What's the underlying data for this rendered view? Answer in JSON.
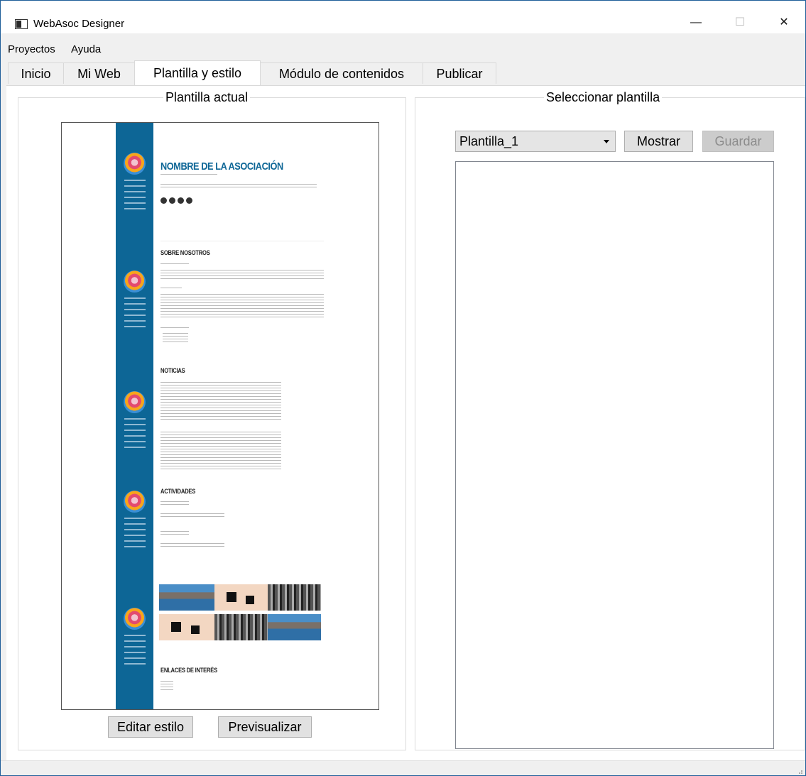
{
  "window": {
    "title": "WebAsoc Designer",
    "controls": {
      "minimize": "—",
      "maximize": "☐",
      "close": "✕"
    }
  },
  "menu": {
    "items": [
      "Proyectos",
      "Ayuda"
    ]
  },
  "tabs": [
    "Inicio",
    "Mi Web",
    "Plantilla y estilo",
    "Módulo de contenidos",
    "Publicar"
  ],
  "active_tab": "Plantilla y estilo",
  "left_panel": {
    "legend": "Plantilla actual",
    "preview": {
      "site_title": "NOMBRE DE LA ASOCIACIÓN",
      "sections": [
        "SOBRE NOSOTROS",
        "NOTICIAS",
        "ACTIVIDADES",
        "ENLACES DE INTERÉS"
      ]
    },
    "buttons": {
      "edit_style": "Editar estilo",
      "preview": "Previsualizar"
    }
  },
  "right_panel": {
    "legend": "Seleccionar plantilla",
    "template_select": {
      "selected": "Plantilla_1"
    },
    "buttons": {
      "show": "Mostrar",
      "save": "Guardar"
    }
  },
  "colors": {
    "accent": "#0d6696",
    "window_border": "#1f5e99"
  }
}
